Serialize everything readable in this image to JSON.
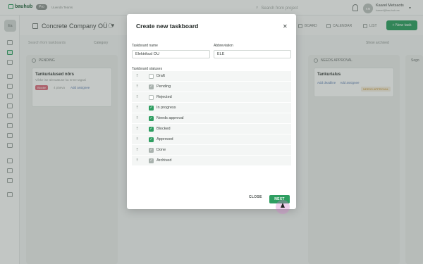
{
  "app": {
    "logo": "bauhub",
    "plan": "Pro",
    "upgrade": "Uuenda Teams"
  },
  "topbar": {
    "search_placeholder": "Search from project",
    "user_initials": "KM",
    "user_name": "Kaarel Metsaots",
    "user_email": "kaarel@bauhub.ee"
  },
  "sidebar": {
    "workspace_initials": "Ea"
  },
  "header": {
    "board_title": "Concrete Company OÜ",
    "tabs": [
      "BOARD",
      "CALENDAR",
      "LIST"
    ],
    "new_task": "+ New task"
  },
  "filters": {
    "search": "Search from taskboards",
    "category": "Category",
    "show_archived": "Show archived"
  },
  "columns": [
    {
      "name": "PENDING",
      "cards": [
        {
          "title": "Tankurialused nõrs",
          "sub": "Võtke ise ülevaatuse ka enne tagasi",
          "tag": "Blocke",
          "meta": "4 päeva",
          "link": "Add assignee"
        }
      ]
    },
    {
      "name": "NEEDS APPROVAL",
      "cards": [
        {
          "title": "Tankurialus",
          "sub": "",
          "tag": "",
          "meta": "",
          "link": "Add deadline",
          "link2": "Add assignee",
          "status": "NEEDS APPROVAL"
        }
      ]
    },
    {
      "name": "Sego",
      "cards": []
    }
  ],
  "modal": {
    "title": "Create new taskboard",
    "close_icon": "close-icon",
    "name_label": "Taskboard name",
    "name_value": "Elektrikud OÜ",
    "abbr_label": "Abbreviation",
    "abbr_value": "ELE",
    "statuses_label": "Taskboard statuses",
    "statuses": [
      {
        "label": "Draft",
        "state": "off"
      },
      {
        "label": "Pending",
        "state": "dis"
      },
      {
        "label": "Rejected",
        "state": "off"
      },
      {
        "label": "In progress",
        "state": "on"
      },
      {
        "label": "Needs approval",
        "state": "on"
      },
      {
        "label": "Blocked",
        "state": "on"
      },
      {
        "label": "Approved",
        "state": "on"
      },
      {
        "label": "Done",
        "state": "dis"
      },
      {
        "label": "Archived",
        "state": "dis"
      }
    ],
    "close_button": "CLOSE",
    "next_button": "NEXT"
  },
  "colors": {
    "accent": "#2e9e61"
  }
}
